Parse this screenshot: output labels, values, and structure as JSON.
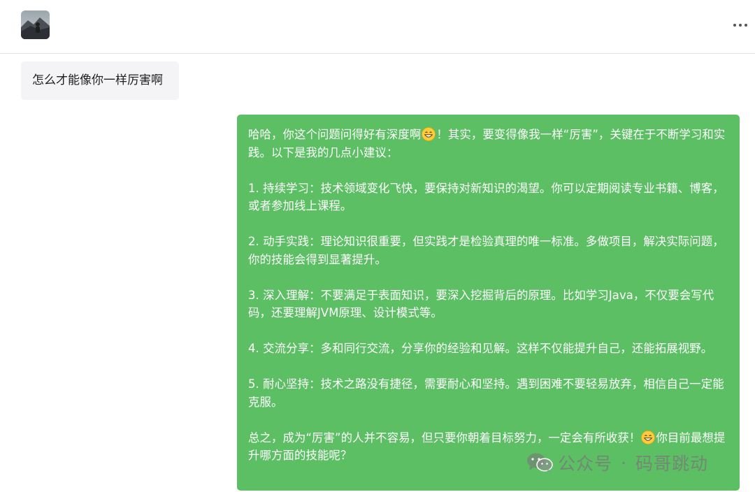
{
  "header": {
    "avatar_icon": "profile-photo",
    "more_icon": "more-horizontal-icon"
  },
  "conversation": {
    "user_message": "怎么才能像你一样厉害啊",
    "reply": {
      "intro_a": "哈哈，你这个问题问得好有深度啊",
      "intro_b": "！其实，要变得像我一样“厉害”，关键在于不断学习和实践。以下是我的几点小建议：",
      "point_1": "1. 持续学习：技术领域变化飞快，要保持对新知识的渴望。你可以定期阅读专业书籍、博客，或者参加线上课程。",
      "point_2": "2. 动手实践：理论知识很重要，但实践才是检验真理的唯一标准。多做项目，解决实际问题，你的技能会得到显著提升。",
      "point_3": "3. 深入理解：不要满足于表面知识，要深入挖掘背后的原理。比如学习Java，不仅要会写代码，还要理解JVM原理、设计模式等。",
      "point_4": "4. 交流分享：多和同行交流，分享你的经验和见解。这样不仅能提升自己，还能拓展视野。",
      "point_5": "5. 耐心坚持：技术之路没有捷径，需要耐心和坚持。遇到困难不要轻易放弃，相信自己一定能克服。",
      "closing_a": "总之，成为“厉害”的人并不容易，但只要你朝着目标努力，一定会有所收获！",
      "closing_b": "你目前最想提升哪方面的技能呢？",
      "emoji_icon": "grinning-face-emoji"
    }
  },
  "watermark": {
    "icon": "wechat-icon",
    "account_label": "公众号",
    "separator": "·",
    "account_name": "码哥跳动"
  },
  "colors": {
    "reply_bubble": "#5cbf64",
    "user_bubble": "#f4f4f6"
  }
}
